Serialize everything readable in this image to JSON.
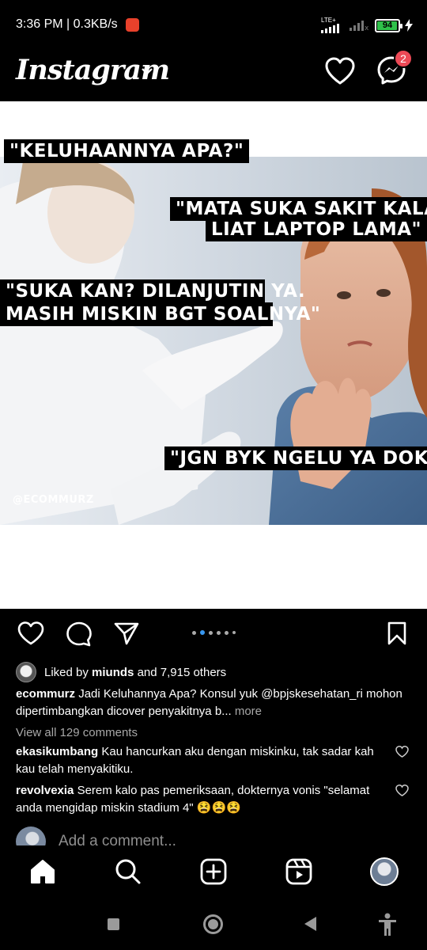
{
  "status_bar": {
    "time_speed": "3:36 PM | 0.3KB/s",
    "network": "LTE+",
    "battery": "94"
  },
  "header": {
    "brand": "Instagram",
    "notification_badge": "2"
  },
  "post": {
    "image_captions": {
      "caption_1": "\"KELUHAANNYA APA?\"",
      "caption_2_line1": "\"MATA SUKA SAKIT KALAU",
      "caption_2_line2": "LIAT LAPTOP LAMA\"",
      "caption_3_line1": "\"SUKA KAN? DILANJUTIN YA.",
      "caption_3_line2": "MASIH MISKIN BGT SOALNYA\"",
      "caption_4": "\"JGN BYK NGELU YA DOK?\"",
      "watermark": "@ECOMMURZ"
    },
    "carousel": {
      "count": 6,
      "active_index": 1
    },
    "likes": {
      "prefix": "Liked by",
      "user": "miunds",
      "suffix": "and 7,915 others"
    },
    "caption": {
      "user": "ecommurz",
      "text": "Jadi Keluhannya Apa? Konsul yuk @bpjskesehatan_ri mohon dipertimbangkan dicover penyakitnya b...",
      "more": "more"
    },
    "view_all": "View all 129 comments",
    "comments": [
      {
        "user": "ekasikumbang",
        "text": "Kau hancurkan aku dengan miskinku, tak sadar kah kau telah menyakitiku."
      },
      {
        "user": "revolvexia",
        "text": "Serem kalo pas pemeriksaan, dokternya vonis \"selamat anda mengidap miskin stadium 4\" 😫😫😫"
      }
    ],
    "add_comment_placeholder": "Add a comment..."
  },
  "colors": {
    "badge": "#ed4956",
    "active_dot": "#3897f0",
    "battery": "#2fc14a"
  }
}
